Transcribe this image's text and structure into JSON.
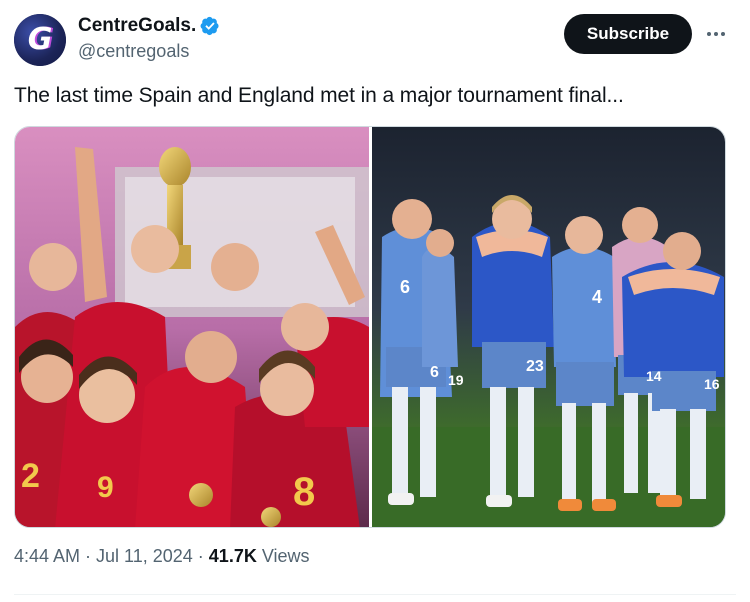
{
  "post": {
    "author": {
      "display_name": "CentreGoals.",
      "handle": "@centregoals",
      "avatar_letter": "G",
      "verified": true
    },
    "subscribe_label": "Subscribe",
    "text": "The last time Spain and England met in a major tournament final...",
    "media": {
      "left_photo": "Spain players celebrating with trophy",
      "right_photo": "England players dejected on pitch",
      "jersey_numbers": {
        "spain_front": "8",
        "spain_left": "2",
        "spain_center": "9",
        "england_left": "6",
        "england_left_shorts": "6",
        "england_shorts_b": "19",
        "england_center_shorts": "23",
        "england_right": "4",
        "england_right_shorts": "14",
        "england_far_right_shorts": "16"
      }
    },
    "meta": {
      "time": "4:44 AM",
      "separator": "·",
      "date": "Jul 11, 2024",
      "views_count": "41.7K",
      "views_label": "Views"
    }
  },
  "colors": {
    "accent_blue": "#1d9bf0",
    "text_primary": "#0f1419",
    "text_secondary": "#536471",
    "spain_red": "#c8102e",
    "england_blue": "#5f8fd8"
  },
  "icons": {
    "verified": "verified-badge-icon",
    "more": "more-horizontal-icon"
  }
}
